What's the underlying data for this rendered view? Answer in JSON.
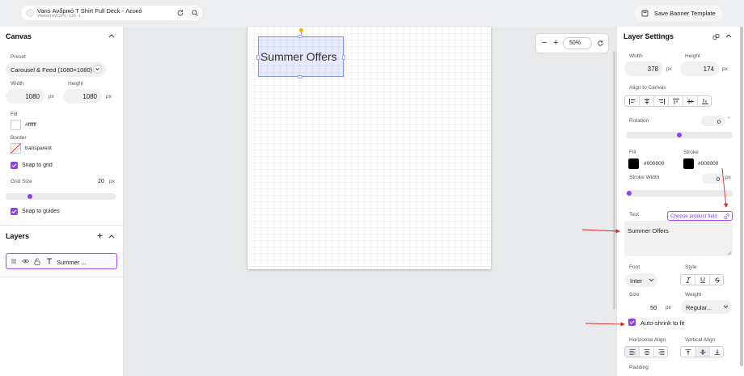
{
  "topbar": {
    "product_title": "Vans Ανδρικό T Shirt Full Deck - Λευκό",
    "product_sku": "VN000TAVC5F1-126-1",
    "save_label": "Save Banner Template"
  },
  "canvas_panel": {
    "title": "Canvas",
    "preset_label": "Preset",
    "preset_value": "Carousel & Feed (1080×1080)",
    "width_label": "Width",
    "width_value": "1080",
    "height_label": "Height",
    "height_value": "1080",
    "unit": "px",
    "fill_label": "Fill",
    "fill_value": "#ffffff",
    "border_label": "Border",
    "border_value": "transparent",
    "snap_grid_label": "Snap to grid",
    "grid_size_label": "Grid Size",
    "grid_size_value": "20",
    "grid_slider_fraction": 0.2,
    "snap_guides_label": "Snap to guides"
  },
  "layers_panel": {
    "title": "Layers",
    "items": [
      {
        "name": "Summer ..."
      }
    ]
  },
  "canvas": {
    "text": "Summer Offers",
    "zoom": "50%"
  },
  "layer_settings": {
    "title": "Layer Settings",
    "width_label": "Width",
    "width_value": "378",
    "height_label": "Height",
    "height_value": "174",
    "unit": "px",
    "align_label": "Align to Canvas",
    "rotation_label": "Rotation",
    "rotation_value": "0",
    "rotation_unit": "°",
    "rotation_slider_fraction": 0.5,
    "fill_label": "Fill",
    "fill_value": "#000000",
    "stroke_label": "Stroke",
    "stroke_value": "#000000",
    "stroke_width_label": "Stroke Width",
    "stroke_width_value": "0",
    "stroke_slider_fraction": 0.0,
    "text_label": "Text",
    "choose_field_label": "Choose product field",
    "text_value": "Summer Offers",
    "font_label": "Font",
    "font_value": "Inter",
    "style_label": "Style",
    "size_label": "Size",
    "size_value": "50",
    "weight_label": "Weight",
    "weight_value": "Regular...",
    "auto_shrink_label": "Auto-shrink to fit",
    "h_align_label": "Horizontal Align",
    "v_align_label": "Vertical Align",
    "padding_label": "Padding"
  },
  "colors": {
    "accent": "#8e3ff0",
    "annotation_arrow": "#d42a2a",
    "selection": "#7d8df0"
  }
}
